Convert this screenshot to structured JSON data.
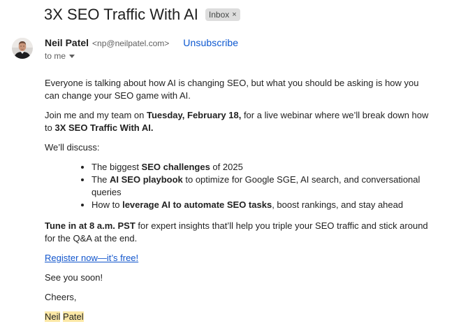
{
  "email": {
    "subject": "3X SEO Traffic With AI",
    "label_chip": "Inbox",
    "label_close_glyph": "×",
    "sender": {
      "name": "Neil Patel",
      "email": "<np@neilpatel.com>",
      "avatar_icon": "avatar-photo"
    },
    "unsubscribe": "Unsubscribe",
    "recipient": "to me",
    "body": {
      "p1": "Everyone is talking about how AI is changing SEO, but what you should be asking is how you can change your SEO game with AI.",
      "p2": {
        "a": "Join me and my team on ",
        "b": "Tuesday, February 18,",
        "c": " for a live webinar where we’ll break down how to ",
        "d": "3X SEO Traffic With AI."
      },
      "p3": "We’ll discuss:",
      "bullets": [
        {
          "a": "The biggest ",
          "b": "SEO challenges",
          "c": " of 2025"
        },
        {
          "a": "The ",
          "b": "AI SEO playbook",
          "c": " to optimize for Google SGE, AI search, and conversational queries"
        },
        {
          "a": "How to ",
          "b": "leverage AI to automate SEO tasks",
          "c": ", boost rankings, and stay ahead"
        }
      ],
      "p4": {
        "a": "Tune in at 8 a.m. PST",
        "b": " for expert insights that’ll help you triple your SEO traffic and stick around for the Q&A at the end."
      },
      "link": "Register now—it’s free!",
      "p5": "See you soon!",
      "p6": "Cheers,",
      "signature_first": "Neil",
      "signature_last": "Patel"
    }
  },
  "colors": {
    "link": "#1155cc",
    "unsubscribe": "#0b57d0",
    "highlight": "#fce8a6",
    "chip_bg": "#dddddd"
  }
}
